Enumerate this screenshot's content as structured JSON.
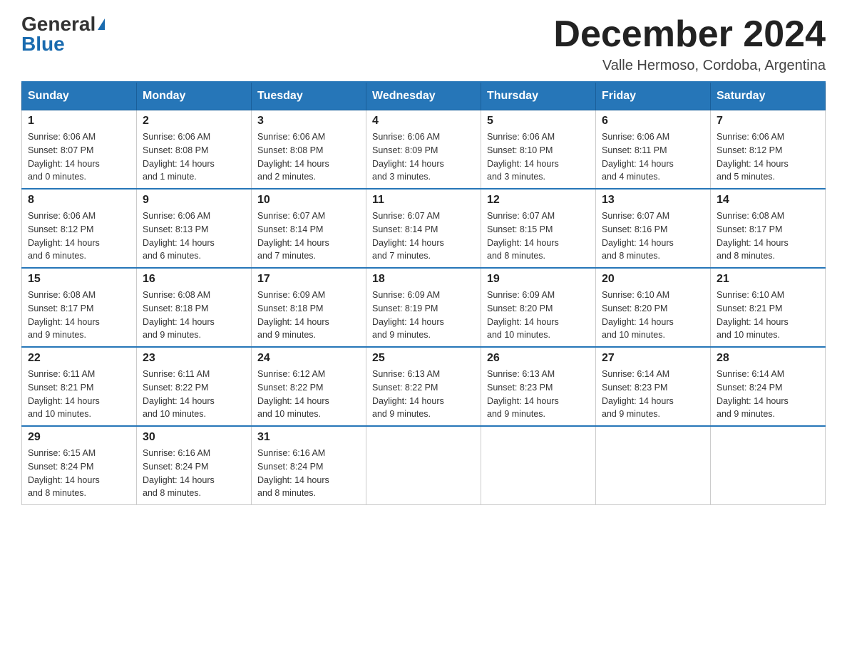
{
  "header": {
    "logo_general": "General",
    "logo_blue": "Blue",
    "title": "December 2024",
    "subtitle": "Valle Hermoso, Cordoba, Argentina"
  },
  "days_of_week": [
    "Sunday",
    "Monday",
    "Tuesday",
    "Wednesday",
    "Thursday",
    "Friday",
    "Saturday"
  ],
  "weeks": [
    [
      {
        "day": "1",
        "sunrise": "6:06 AM",
        "sunset": "8:07 PM",
        "daylight": "14 hours and 0 minutes."
      },
      {
        "day": "2",
        "sunrise": "6:06 AM",
        "sunset": "8:08 PM",
        "daylight": "14 hours and 1 minute."
      },
      {
        "day": "3",
        "sunrise": "6:06 AM",
        "sunset": "8:08 PM",
        "daylight": "14 hours and 2 minutes."
      },
      {
        "day": "4",
        "sunrise": "6:06 AM",
        "sunset": "8:09 PM",
        "daylight": "14 hours and 3 minutes."
      },
      {
        "day": "5",
        "sunrise": "6:06 AM",
        "sunset": "8:10 PM",
        "daylight": "14 hours and 3 minutes."
      },
      {
        "day": "6",
        "sunrise": "6:06 AM",
        "sunset": "8:11 PM",
        "daylight": "14 hours and 4 minutes."
      },
      {
        "day": "7",
        "sunrise": "6:06 AM",
        "sunset": "8:12 PM",
        "daylight": "14 hours and 5 minutes."
      }
    ],
    [
      {
        "day": "8",
        "sunrise": "6:06 AM",
        "sunset": "8:12 PM",
        "daylight": "14 hours and 6 minutes."
      },
      {
        "day": "9",
        "sunrise": "6:06 AM",
        "sunset": "8:13 PM",
        "daylight": "14 hours and 6 minutes."
      },
      {
        "day": "10",
        "sunrise": "6:07 AM",
        "sunset": "8:14 PM",
        "daylight": "14 hours and 7 minutes."
      },
      {
        "day": "11",
        "sunrise": "6:07 AM",
        "sunset": "8:14 PM",
        "daylight": "14 hours and 7 minutes."
      },
      {
        "day": "12",
        "sunrise": "6:07 AM",
        "sunset": "8:15 PM",
        "daylight": "14 hours and 8 minutes."
      },
      {
        "day": "13",
        "sunrise": "6:07 AM",
        "sunset": "8:16 PM",
        "daylight": "14 hours and 8 minutes."
      },
      {
        "day": "14",
        "sunrise": "6:08 AM",
        "sunset": "8:17 PM",
        "daylight": "14 hours and 8 minutes."
      }
    ],
    [
      {
        "day": "15",
        "sunrise": "6:08 AM",
        "sunset": "8:17 PM",
        "daylight": "14 hours and 9 minutes."
      },
      {
        "day": "16",
        "sunrise": "6:08 AM",
        "sunset": "8:18 PM",
        "daylight": "14 hours and 9 minutes."
      },
      {
        "day": "17",
        "sunrise": "6:09 AM",
        "sunset": "8:18 PM",
        "daylight": "14 hours and 9 minutes."
      },
      {
        "day": "18",
        "sunrise": "6:09 AM",
        "sunset": "8:19 PM",
        "daylight": "14 hours and 9 minutes."
      },
      {
        "day": "19",
        "sunrise": "6:09 AM",
        "sunset": "8:20 PM",
        "daylight": "14 hours and 10 minutes."
      },
      {
        "day": "20",
        "sunrise": "6:10 AM",
        "sunset": "8:20 PM",
        "daylight": "14 hours and 10 minutes."
      },
      {
        "day": "21",
        "sunrise": "6:10 AM",
        "sunset": "8:21 PM",
        "daylight": "14 hours and 10 minutes."
      }
    ],
    [
      {
        "day": "22",
        "sunrise": "6:11 AM",
        "sunset": "8:21 PM",
        "daylight": "14 hours and 10 minutes."
      },
      {
        "day": "23",
        "sunrise": "6:11 AM",
        "sunset": "8:22 PM",
        "daylight": "14 hours and 10 minutes."
      },
      {
        "day": "24",
        "sunrise": "6:12 AM",
        "sunset": "8:22 PM",
        "daylight": "14 hours and 10 minutes."
      },
      {
        "day": "25",
        "sunrise": "6:13 AM",
        "sunset": "8:22 PM",
        "daylight": "14 hours and 9 minutes."
      },
      {
        "day": "26",
        "sunrise": "6:13 AM",
        "sunset": "8:23 PM",
        "daylight": "14 hours and 9 minutes."
      },
      {
        "day": "27",
        "sunrise": "6:14 AM",
        "sunset": "8:23 PM",
        "daylight": "14 hours and 9 minutes."
      },
      {
        "day": "28",
        "sunrise": "6:14 AM",
        "sunset": "8:24 PM",
        "daylight": "14 hours and 9 minutes."
      }
    ],
    [
      {
        "day": "29",
        "sunrise": "6:15 AM",
        "sunset": "8:24 PM",
        "daylight": "14 hours and 8 minutes."
      },
      {
        "day": "30",
        "sunrise": "6:16 AM",
        "sunset": "8:24 PM",
        "daylight": "14 hours and 8 minutes."
      },
      {
        "day": "31",
        "sunrise": "6:16 AM",
        "sunset": "8:24 PM",
        "daylight": "14 hours and 8 minutes."
      },
      null,
      null,
      null,
      null
    ]
  ],
  "labels": {
    "sunrise": "Sunrise:",
    "sunset": "Sunset:",
    "daylight": "Daylight:"
  }
}
